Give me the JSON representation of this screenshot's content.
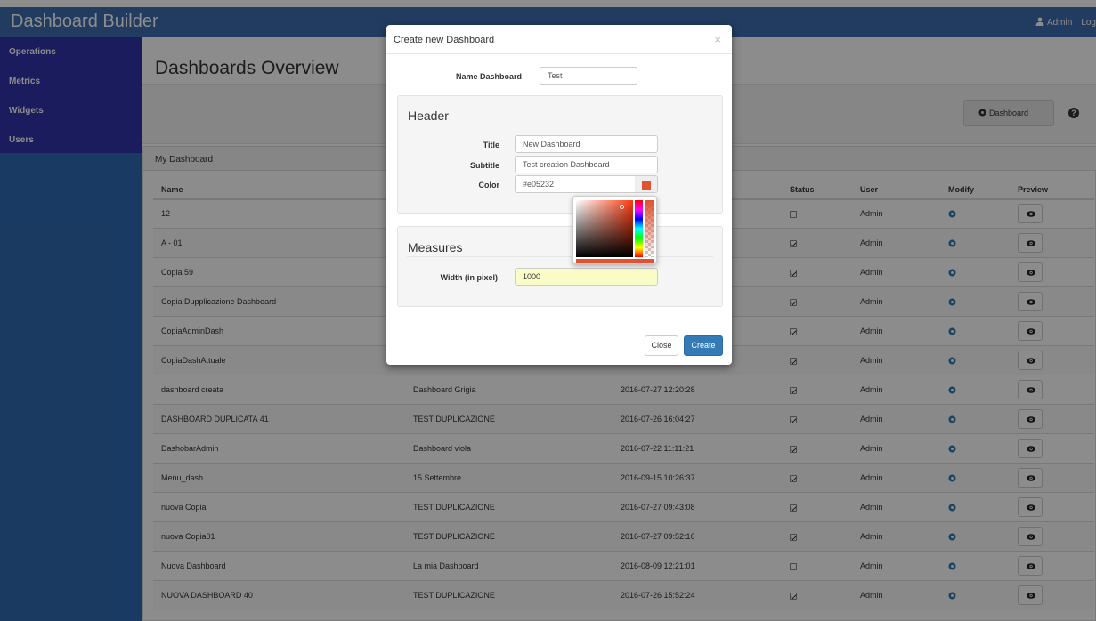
{
  "app": {
    "brand": "Dashboard Builder",
    "user": "Admin",
    "logout": "Log"
  },
  "sidebar": {
    "items": [
      {
        "label": "Operations"
      },
      {
        "label": "Metrics"
      },
      {
        "label": "Widgets"
      },
      {
        "label": "Users"
      }
    ]
  },
  "main": {
    "title": "Dashboards Overview",
    "toolbar_button": "Dashboard"
  },
  "panel": {
    "heading": "My Dashboard"
  },
  "table": {
    "headers": {
      "name": "Name",
      "status": "Status",
      "user": "User",
      "modify": "Modify",
      "preview": "Preview"
    },
    "rows": [
      {
        "name": "12",
        "title": "",
        "date": "",
        "status": false,
        "user": "Admin"
      },
      {
        "name": "A - 01",
        "title": "",
        "date": "",
        "status": true,
        "user": "Admin"
      },
      {
        "name": "Copia 59",
        "title": "",
        "date": "",
        "status": true,
        "user": "Admin"
      },
      {
        "name": "Copia Dupplicazione Dashboard",
        "title": "",
        "date": "",
        "status": true,
        "user": "Admin"
      },
      {
        "name": "CopiaAdminDash",
        "title": "",
        "date": "",
        "status": true,
        "user": "Admin"
      },
      {
        "name": "CopiaDashAttuale",
        "title": "",
        "date": "",
        "status": true,
        "user": "Admin"
      },
      {
        "name": "dashboard creata",
        "title": "Dashboard Grigia",
        "date": "2016-07-27 12:20:28",
        "status": true,
        "user": "Admin"
      },
      {
        "name": "DASHBOARD DUPLICATA 41",
        "title": "TEST DUPLICAZIONE",
        "date": "2016-07-26 16:04:27",
        "status": true,
        "user": "Admin"
      },
      {
        "name": "DashobarAdmin",
        "title": "Dashboard viola",
        "date": "2016-07-22 11:11:21",
        "status": true,
        "user": "Admin"
      },
      {
        "name": "Menu_dash",
        "title": "15 Settembre",
        "date": "2016-09-15 10:26:37",
        "status": true,
        "user": "Admin"
      },
      {
        "name": "nuova Copia",
        "title": "TEST DUPLICAZIONE",
        "date": "2016-07-27 09:43:08",
        "status": true,
        "user": "Admin"
      },
      {
        "name": "nuova Copia01",
        "title": "TEST DUPLICAZIONE",
        "date": "2016-07-27 09:52:16",
        "status": true,
        "user": "Admin"
      },
      {
        "name": "Nuova Dashboard",
        "title": "La mia Dashboard",
        "date": "2016-08-09 12:21:01",
        "status": false,
        "user": "Admin"
      },
      {
        "name": "NUOVA DASHBOARD 40",
        "title": "TEST DUPLICAZIONE",
        "date": "2016-07-26 15:52:24",
        "status": true,
        "user": "Admin"
      }
    ]
  },
  "modal": {
    "title": "Create new Dashboard",
    "close_symbol": "×",
    "name_label": "Name Dashboard",
    "name_value": "Test",
    "header_legend": "Header",
    "title_label": "Title",
    "title_value": "New Dashboard",
    "subtitle_label": "Subtitle",
    "subtitle_value": "Test creation Dashboard",
    "color_label": "Color",
    "color_value": "#e05232",
    "measures_legend": "Measures",
    "width_label": "Width (in pixel)",
    "width_value": "1000",
    "close_button": "Close",
    "create_button": "Create"
  },
  "colors": {
    "navbar": "#3c6db0",
    "sidebar": "#2f6ab3",
    "sidebar_header": "#3134a9",
    "primary": "#337ab7",
    "picked": "#e05232"
  },
  "icons": {
    "user": "user-icon",
    "gear": "gear-icon",
    "eye": "eye-icon",
    "help": "question-circle-icon"
  }
}
